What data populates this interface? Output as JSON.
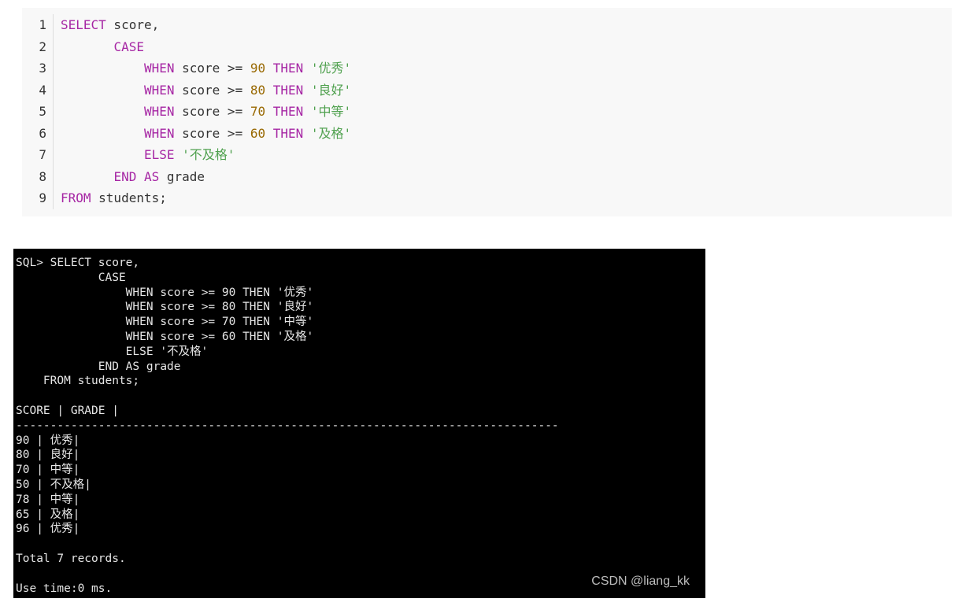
{
  "code_block": {
    "lines": [
      {
        "num": "1",
        "tokens": [
          {
            "t": "SELECT",
            "c": "kw"
          },
          {
            "t": " score,",
            "c": ""
          }
        ]
      },
      {
        "num": "2",
        "tokens": [
          {
            "t": "       ",
            "c": ""
          },
          {
            "t": "CASE",
            "c": "kw"
          }
        ]
      },
      {
        "num": "3",
        "tokens": [
          {
            "t": "           ",
            "c": ""
          },
          {
            "t": "WHEN",
            "c": "kw"
          },
          {
            "t": " score >= ",
            "c": ""
          },
          {
            "t": "90",
            "c": "num"
          },
          {
            "t": " ",
            "c": ""
          },
          {
            "t": "THEN",
            "c": "kw"
          },
          {
            "t": " ",
            "c": ""
          },
          {
            "t": "'优秀'",
            "c": "str"
          }
        ]
      },
      {
        "num": "4",
        "tokens": [
          {
            "t": "           ",
            "c": ""
          },
          {
            "t": "WHEN",
            "c": "kw"
          },
          {
            "t": " score >= ",
            "c": ""
          },
          {
            "t": "80",
            "c": "num"
          },
          {
            "t": " ",
            "c": ""
          },
          {
            "t": "THEN",
            "c": "kw"
          },
          {
            "t": " ",
            "c": ""
          },
          {
            "t": "'良好'",
            "c": "str"
          }
        ]
      },
      {
        "num": "5",
        "tokens": [
          {
            "t": "           ",
            "c": ""
          },
          {
            "t": "WHEN",
            "c": "kw"
          },
          {
            "t": " score >= ",
            "c": ""
          },
          {
            "t": "70",
            "c": "num"
          },
          {
            "t": " ",
            "c": ""
          },
          {
            "t": "THEN",
            "c": "kw"
          },
          {
            "t": " ",
            "c": ""
          },
          {
            "t": "'中等'",
            "c": "str"
          }
        ]
      },
      {
        "num": "6",
        "tokens": [
          {
            "t": "           ",
            "c": ""
          },
          {
            "t": "WHEN",
            "c": "kw"
          },
          {
            "t": " score >= ",
            "c": ""
          },
          {
            "t": "60",
            "c": "num"
          },
          {
            "t": " ",
            "c": ""
          },
          {
            "t": "THEN",
            "c": "kw"
          },
          {
            "t": " ",
            "c": ""
          },
          {
            "t": "'及格'",
            "c": "str"
          }
        ]
      },
      {
        "num": "7",
        "tokens": [
          {
            "t": "           ",
            "c": ""
          },
          {
            "t": "ELSE",
            "c": "kw"
          },
          {
            "t": " ",
            "c": ""
          },
          {
            "t": "'不及格'",
            "c": "str"
          }
        ]
      },
      {
        "num": "8",
        "tokens": [
          {
            "t": "       ",
            "c": ""
          },
          {
            "t": "END",
            "c": "kw"
          },
          {
            "t": " ",
            "c": ""
          },
          {
            "t": "AS",
            "c": "kw"
          },
          {
            "t": " grade",
            "c": ""
          }
        ]
      },
      {
        "num": "9",
        "tokens": [
          {
            "t": "FROM",
            "c": "kw"
          },
          {
            "t": " students;",
            "c": ""
          }
        ]
      }
    ]
  },
  "terminal": {
    "lines": [
      "SQL> SELECT score,",
      "            CASE",
      "                WHEN score >= 90 THEN '优秀'",
      "                WHEN score >= 80 THEN '良好'",
      "                WHEN score >= 70 THEN '中等'",
      "                WHEN score >= 60 THEN '及格'",
      "                ELSE '不及格'",
      "            END AS grade",
      "    FROM students;",
      "",
      "SCORE | GRADE |",
      "-------------------------------------------------------------------------------",
      "90 | 优秀|",
      "80 | 良好|",
      "70 | 中等|",
      "50 | 不及格|",
      "78 | 中等|",
      "65 | 及格|",
      "96 | 优秀|",
      "",
      "Total 7 records.",
      "",
      "Use time:0 ms."
    ],
    "watermark": "CSDN @liang_kk"
  },
  "colors": {
    "keyword": "#a626a4",
    "number": "#986801",
    "string": "#50a14f",
    "code_bg": "#f8f8f8",
    "terminal_bg": "#000000",
    "terminal_fg": "#e6e6e6"
  }
}
